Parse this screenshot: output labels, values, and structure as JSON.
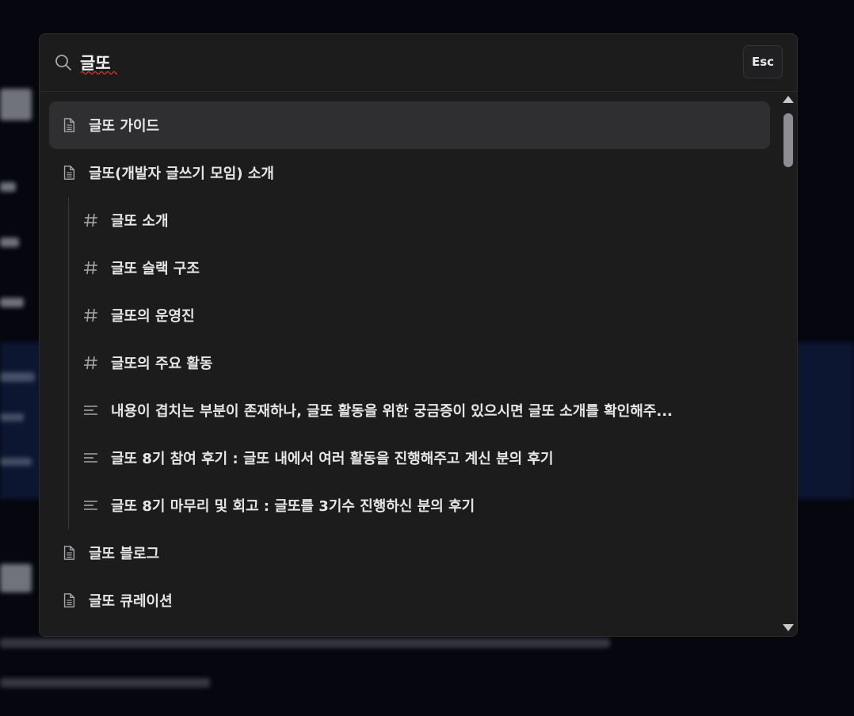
{
  "search": {
    "query": "글또",
    "escape_label": "Esc"
  },
  "results": [
    {
      "kind": "page",
      "icon": "document-icon",
      "label": "글또 가이드",
      "selected": true
    },
    {
      "kind": "page",
      "icon": "document-icon",
      "label": "글또(개발자 글쓰기 모임) 소개",
      "selected": false
    },
    {
      "kind": "heading",
      "icon": "hash-icon",
      "label": "글또 소개"
    },
    {
      "kind": "heading",
      "icon": "hash-icon",
      "label": "글또 슬랙 구조"
    },
    {
      "kind": "heading",
      "icon": "hash-icon",
      "label": "글또의 운영진"
    },
    {
      "kind": "heading",
      "icon": "hash-icon",
      "label": "글또의 주요 활동"
    },
    {
      "kind": "text",
      "icon": "text-lines-icon",
      "label": "내용이 겹치는 부분이 존재하나, 글또 활동을 위한 궁금증이 있으시면 글또 소개를 확인해주..."
    },
    {
      "kind": "text",
      "icon": "text-lines-icon",
      "label": "글또 8기 참여 후기 : 글또 내에서 여러 활동을 진행해주고 계신 분의 후기"
    },
    {
      "kind": "text",
      "icon": "text-lines-icon",
      "label": "글또 8기 마무리 및 회고 : 글또를 3기수 진행하신 분의 후기"
    },
    {
      "kind": "page",
      "icon": "document-icon",
      "label": "글또 블로그",
      "selected": false
    },
    {
      "kind": "page",
      "icon": "document-icon",
      "label": "글또 큐레이션",
      "selected": false
    }
  ],
  "colors": {
    "modal_bg": "#1c1c1d",
    "selected_row": "#2f2f31",
    "backdrop": "#05060e"
  }
}
